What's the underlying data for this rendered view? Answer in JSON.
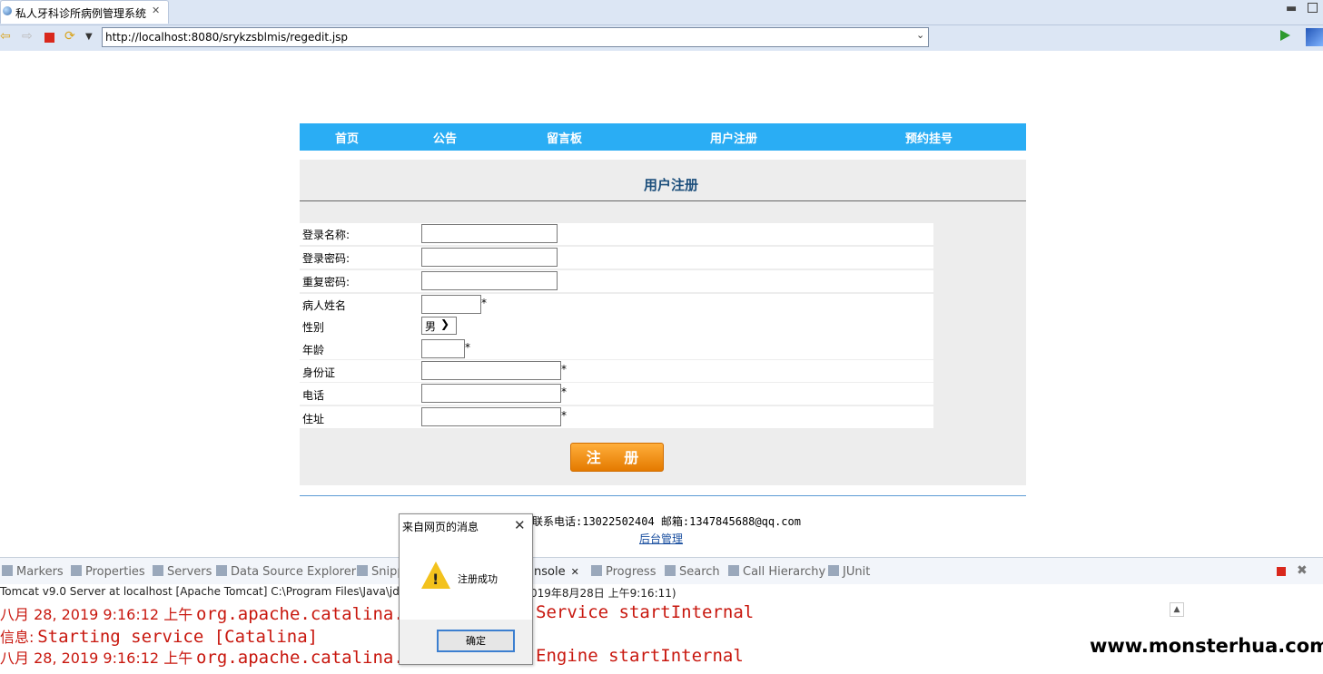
{
  "browser": {
    "tab_title": "私人牙科诊所病例管理系统",
    "url": "http://localhost:8080/srykzsblmis/regedit.jsp"
  },
  "nav": {
    "items": [
      "首页",
      "公告",
      "留言板",
      "用户注册",
      "预约挂号"
    ]
  },
  "form": {
    "title": "用户注册",
    "labels": {
      "login_name": "登录名称:",
      "password": "登录密码:",
      "password_repeat": "重复密码:",
      "patient_name": "病人姓名",
      "gender": "性别",
      "age": "年龄",
      "id_card": "身份证",
      "phone": "电话",
      "address": "住址"
    },
    "required_mark": "*",
    "gender_value": "男",
    "submit_label": "注 册"
  },
  "footer": {
    "contact": "联系电话:13022502404 邮箱:1347845688@qq.com",
    "admin_link": "后台管理"
  },
  "ide": {
    "tabs": [
      "Markers",
      "Properties",
      "Servers",
      "Data Source Explorer",
      "Snipp",
      "nsole",
      "Progress",
      "Search",
      "Call Hierarchy",
      "JUnit"
    ],
    "console_header_left": "Tomcat v9.0 Server at localhost [Apache Tomcat] C:\\Program Files\\Java\\jdk1",
    "console_header_right": "019年8月28日 上午9:16:11)",
    "lines": [
      {
        "date": "八月 28, 2019 9:16:12 上午",
        "left": "org.apache.catalina.c",
        "right": "Service startInternal"
      },
      {
        "date": "信息:",
        "left": "Starting service [Catalina]",
        "right": ""
      },
      {
        "date": "八月 28, 2019 9:16:12 上午",
        "left": "org.apache.catalina.c",
        "right": "Engine startInternal"
      }
    ]
  },
  "dialog": {
    "title": "来自网页的消息",
    "message": "注册成功",
    "ok_label": "确定"
  },
  "watermark": "www.monsterhua.com"
}
